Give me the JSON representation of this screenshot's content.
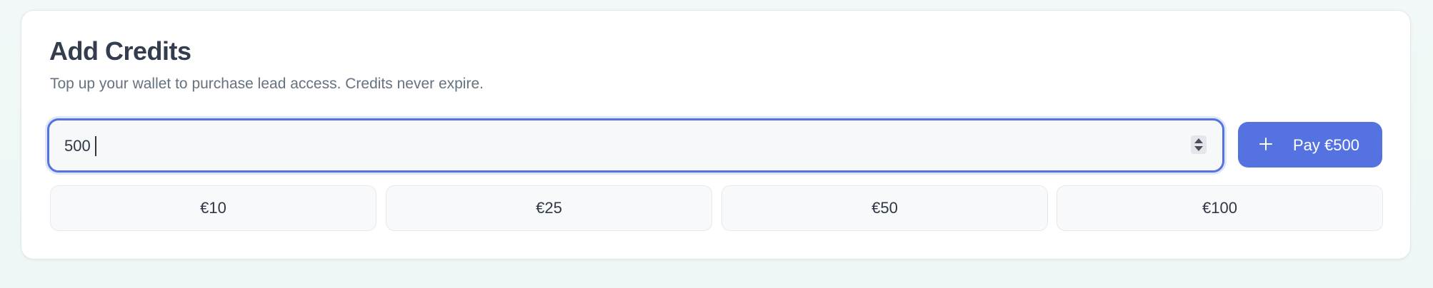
{
  "card": {
    "title": "Add Credits",
    "subtitle": "Top up your wallet to purchase lead access. Credits never expire."
  },
  "amount_input": {
    "value": "500"
  },
  "pay_button": {
    "label": "Pay €500",
    "icon": "plus-icon"
  },
  "presets": [
    {
      "label": "€10"
    },
    {
      "label": "€25"
    },
    {
      "label": "€50"
    },
    {
      "label": "€100"
    }
  ],
  "colors": {
    "accent": "#5473e0",
    "title_text": "#333d4e",
    "muted_text": "#66727f",
    "page_background": "#f1f8f7"
  }
}
